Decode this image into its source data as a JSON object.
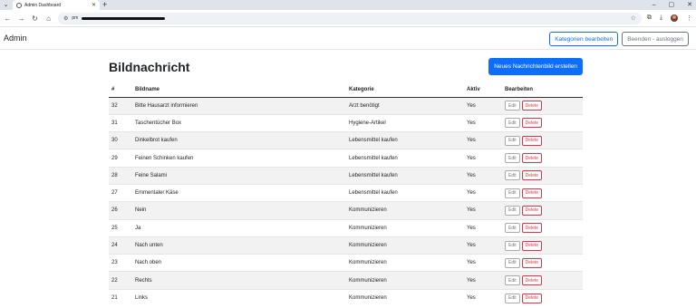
{
  "browser": {
    "tab_title": "Admin Dashboard",
    "new_tab": "+",
    "url_prefix": "pm",
    "controls": [
      "–",
      "▢",
      "✕"
    ]
  },
  "navbar": {
    "brand": "Admin",
    "categories_button": "Kategorien bearbeiten",
    "logout_button": "Beenden - ausloggen"
  },
  "main": {
    "title": "Bildnachricht",
    "new_button": "Neues Nachrichtenbild erstellen"
  },
  "table": {
    "headers": [
      "#",
      "Bildname",
      "Kategorie",
      "Aktiv",
      "Bearbeiten"
    ],
    "edit_label": "Edit",
    "delete_label": "Delete",
    "rows": [
      {
        "id": "32",
        "name": "Bitte Hausarzt informieren",
        "category": "Arzt benötigt",
        "active": "Yes"
      },
      {
        "id": "31",
        "name": "Taschentücher Box",
        "category": "Hygiene-Artikel",
        "active": "Yes"
      },
      {
        "id": "30",
        "name": "Dinkelbrot kaufen",
        "category": "Lebensmittel kaufen",
        "active": "Yes"
      },
      {
        "id": "29",
        "name": "Feinen Schinken kaufen",
        "category": "Lebensmittel kaufen",
        "active": "Yes"
      },
      {
        "id": "28",
        "name": "Feine Salami",
        "category": "Lebensmittel kaufen",
        "active": "Yes"
      },
      {
        "id": "27",
        "name": "Emmentaler Käse",
        "category": "Lebensmittel kaufen",
        "active": "Yes"
      },
      {
        "id": "26",
        "name": "Nein",
        "category": "Kommunizieren",
        "active": "Yes"
      },
      {
        "id": "25",
        "name": "Ja",
        "category": "Kommunizieren",
        "active": "Yes"
      },
      {
        "id": "24",
        "name": "Nach unten",
        "category": "Kommunizieren",
        "active": "Yes"
      },
      {
        "id": "23",
        "name": "Nach oben",
        "category": "Kommunizieren",
        "active": "Yes"
      },
      {
        "id": "22",
        "name": "Rechts",
        "category": "Kommunizieren",
        "active": "Yes"
      },
      {
        "id": "21",
        "name": "Links",
        "category": "Kommunizieren",
        "active": "Yes"
      }
    ]
  },
  "colors": {
    "primary": "#0d6efd",
    "danger": "#dc3545",
    "secondary": "#6c757d"
  }
}
